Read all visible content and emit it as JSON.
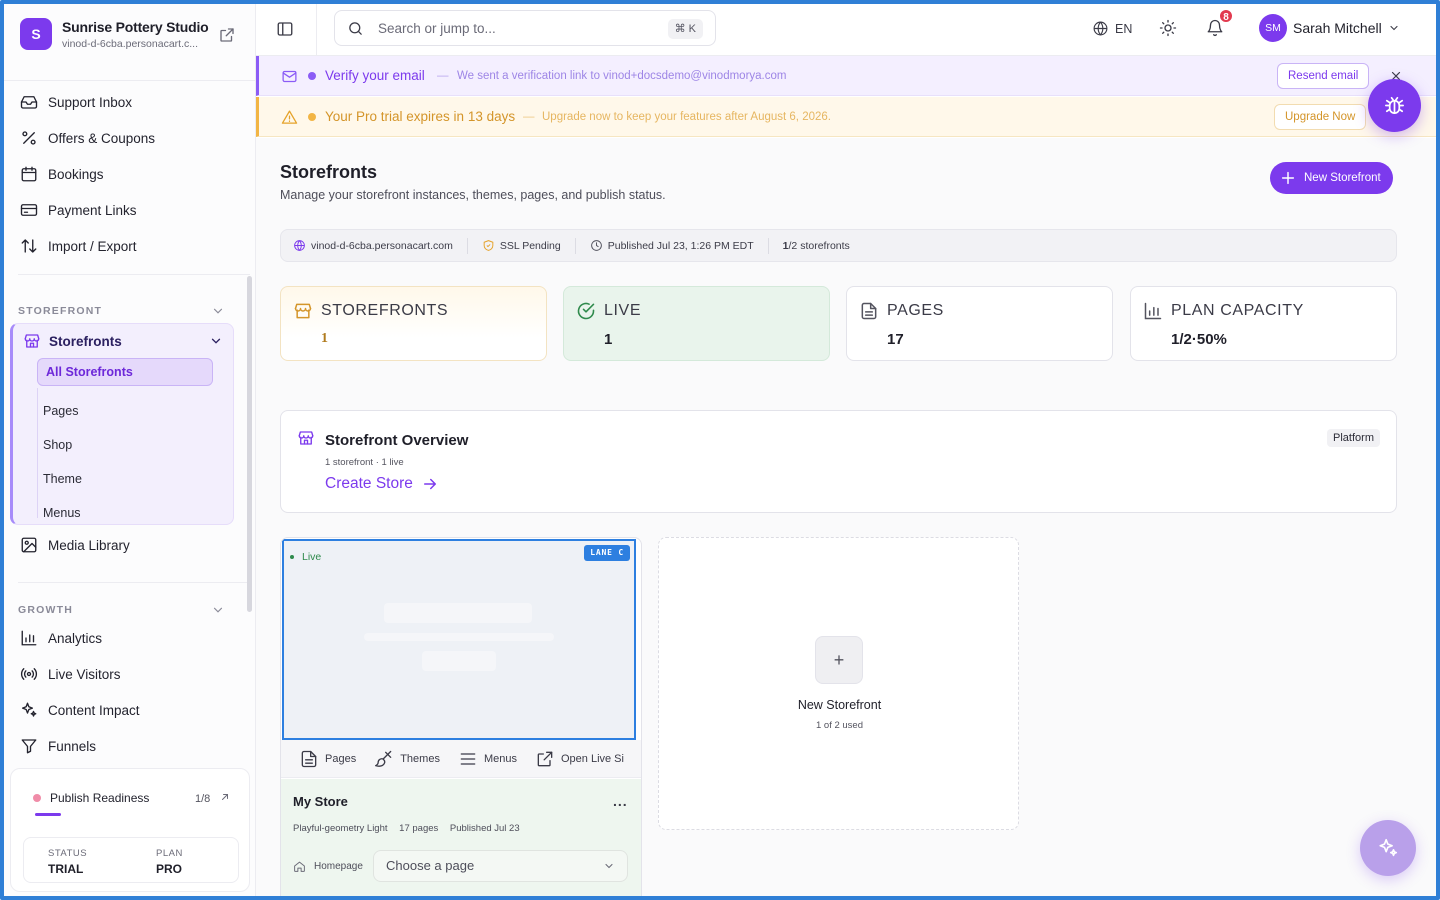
{
  "brand": {
    "initial": "S",
    "name": "Sunrise Pottery Studio",
    "domain": "vinod-d-6cba.personacart.c..."
  },
  "nav_top": [
    {
      "label": "Support Inbox",
      "icon": "inbox-icon"
    },
    {
      "label": "Offers & Coupons",
      "icon": "percent-icon"
    },
    {
      "label": "Bookings",
      "icon": "calendar-icon"
    },
    {
      "label": "Payment Links",
      "icon": "card-icon"
    },
    {
      "label": "Import / Export",
      "icon": "arrows-updown-icon"
    }
  ],
  "section_storefront": {
    "label": "STOREFRONT",
    "group": "Storefronts",
    "items": [
      "All Storefronts",
      "Pages",
      "Shop",
      "Theme",
      "Menus"
    ],
    "active": "All Storefronts",
    "after": "Media Library"
  },
  "section_growth": {
    "label": "GROWTH",
    "items": [
      "Analytics",
      "Live Visitors",
      "Content Impact",
      "Funnels"
    ]
  },
  "readiness": {
    "label": "Publish Readiness",
    "count": "1/8",
    "progress_fraction": 0.125,
    "status_label": "STATUS",
    "status_value": "TRIAL",
    "plan_label": "PLAN",
    "plan_value": "PRO"
  },
  "topbar": {
    "search_placeholder": "Search or jump to...",
    "search_kbd": "⌘ K",
    "language": "EN",
    "notifications_count": "8",
    "user_initials": "SM",
    "user_name": "Sarah Mitchell"
  },
  "banner_verify": {
    "title": "Verify your email",
    "dash": "—",
    "subtitle": "We sent a verification link to vinod+docsdemo@vinodmorya.com",
    "button": "Resend email"
  },
  "banner_trial": {
    "title": "Your Pro trial expires in 13 days",
    "dash": "—",
    "subtitle": "Upgrade now to keep your features after August 6, 2026.",
    "button": "Upgrade Now"
  },
  "page": {
    "title": "Storefronts",
    "subtitle": "Manage your storefront instances, themes, pages, and publish status.",
    "new_button": "New Storefront"
  },
  "infobar": {
    "domain": "vinod-d-6cba.personacart.com",
    "ssl": "SSL Pending",
    "published": "Published Jul 23, 1:26 PM EDT",
    "count_strong": "1",
    "count_rest": "/2 storefronts"
  },
  "stats": [
    {
      "label": "STOREFRONTS",
      "value": "1",
      "icon": "store-icon"
    },
    {
      "label": "LIVE",
      "value": "1",
      "icon": "check-circle-icon"
    },
    {
      "label": "PAGES",
      "value": "17",
      "icon": "document-icon"
    },
    {
      "label": "PLAN CAPACITY",
      "value": "1/2·50%",
      "icon": "bar-chart-icon"
    }
  ],
  "overview": {
    "title": "Storefront Overview",
    "subtitle": "1 storefront · 1 live",
    "link": "Create Store",
    "badge": "Platform"
  },
  "store_card": {
    "live_label": "Live",
    "lane_label": "LANE C",
    "tabs": [
      "Pages",
      "Themes",
      "Menus",
      "Open Live Si"
    ],
    "name": "My Store",
    "more": "...",
    "theme": "Playful-geometry Light",
    "pages": "17 pages",
    "published": "Published Jul 23",
    "homepage_label": "Homepage",
    "homepage_select": "Choose a page"
  },
  "new_card": {
    "plus": "+",
    "title": "New Storefront",
    "subtitle": "1 of 2 used"
  },
  "colors": {
    "accent": "#7c3aed",
    "accent_light": "#f4efff",
    "warning": "#f2b544",
    "success_bg": "#eef6ef",
    "badge_red": "#e23a4f",
    "preview_border": "#2d7fe0"
  }
}
